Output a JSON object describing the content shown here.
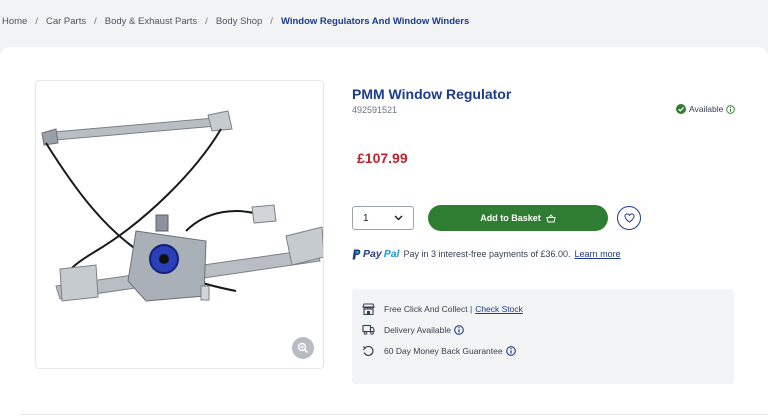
{
  "breadcrumb": {
    "items": [
      "Home",
      "Car Parts",
      "Body & Exhaust Parts",
      "Body Shop"
    ],
    "current": "Window Regulators And Window Winders",
    "separator": "/"
  },
  "product": {
    "title": "PMM Window Regulator",
    "sku": "492591521",
    "availability": "Available",
    "price": "£107.99",
    "image_alt": "Window regulator product image"
  },
  "purchase": {
    "quantity": "1",
    "add_to_basket": "Add to Basket"
  },
  "paypal": {
    "logo_pay": "Pay",
    "logo_pal": "Pal",
    "message": "Pay in 3 interest-free payments of £36.00.",
    "learn_more": "Learn more"
  },
  "services": [
    {
      "text": "Free Click And Collect |",
      "link": "Check Stock",
      "icon": "store-icon"
    },
    {
      "text": "Delivery Available",
      "link": "",
      "icon": "truck-icon"
    },
    {
      "text": "60 Day Money Back Guarantee",
      "link": "",
      "icon": "return-icon"
    }
  ],
  "colors": {
    "brand_blue": "#1e3a8a",
    "price_red": "#c0222b",
    "basket_green": "#2f7d32",
    "available_green": "#2e7d32"
  }
}
